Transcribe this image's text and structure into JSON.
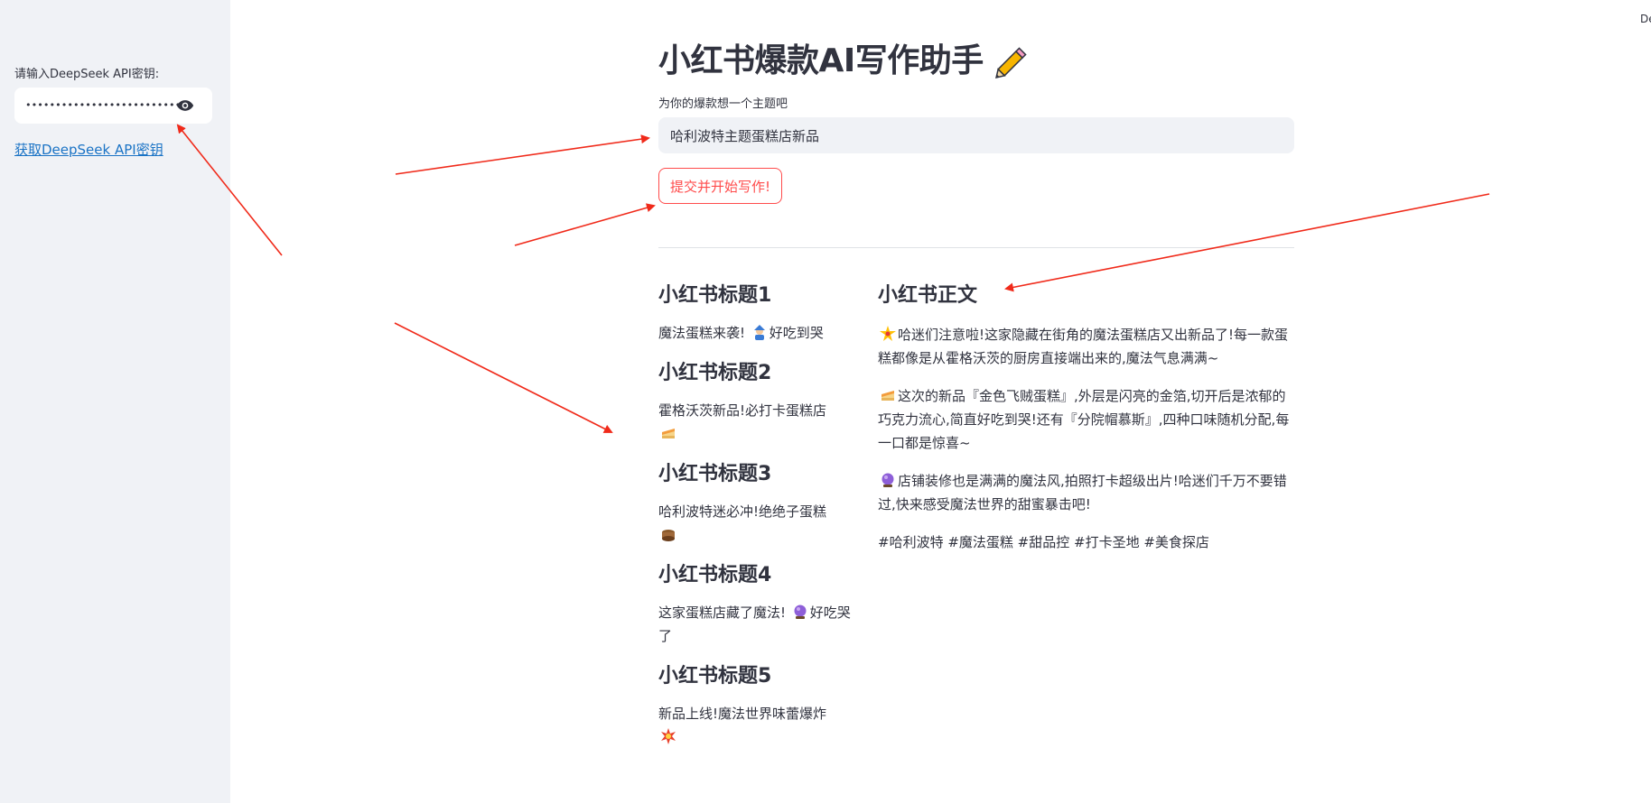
{
  "sidebar": {
    "api_label": "请输入DeepSeek API密钥:",
    "api_value": "••••••••••••••••••••••••••••••••••••",
    "api_link": "获取DeepSeek API密钥"
  },
  "corner_text": "De",
  "main": {
    "title": "小红书爆款AI写作助手",
    "topic_label": "为你的爆款想一个主题吧",
    "topic_value": "哈利波特主题蛋糕店新品",
    "submit_label": "提交并开始写作!"
  },
  "titles": [
    {
      "heading": "小红书标题1",
      "text": "魔法蛋糕来袭! ",
      "text2": "好吃到哭",
      "emoji": "mage-icon"
    },
    {
      "heading": "小红书标题2",
      "text": "霍格沃茨新品!必打卡蛋糕店",
      "emoji": "cake-icon"
    },
    {
      "heading": "小红书标题3",
      "text": "哈利波特迷必冲!绝绝子蛋糕",
      "emoji": "chocolate-cake-icon"
    },
    {
      "heading": "小红书标题4",
      "text": "这家蛋糕店藏了魔法! ",
      "text2": "好吃哭了",
      "emoji": "crystal-ball-icon"
    },
    {
      "heading": "小红书标题5",
      "text": "新品上线!魔法世界味蕾爆炸",
      "emoji": "explosion-icon"
    }
  ],
  "body": {
    "heading": "小红书正文",
    "para1": "哈迷们注意啦!这家隐藏在街角的魔法蛋糕店又出新品了!每一款蛋糕都像是从霍格沃茨的厨房直接端出来的,魔法气息满满~",
    "para2": "这次的新品『金色飞贼蛋糕』,外层是闪亮的金箔,切开后是浓郁的巧克力流心,简直好吃到哭!还有『分院帽慕斯』,四种口味随机分配,每一口都是惊喜~",
    "para3": "店铺装修也是满满的魔法风,拍照打卡超级出片!哈迷们千万不要错过,快来感受魔法世界的甜蜜暴击吧!",
    "tags": "#哈利波特 #魔法蛋糕 #甜品控 #打卡圣地 #美食探店"
  }
}
